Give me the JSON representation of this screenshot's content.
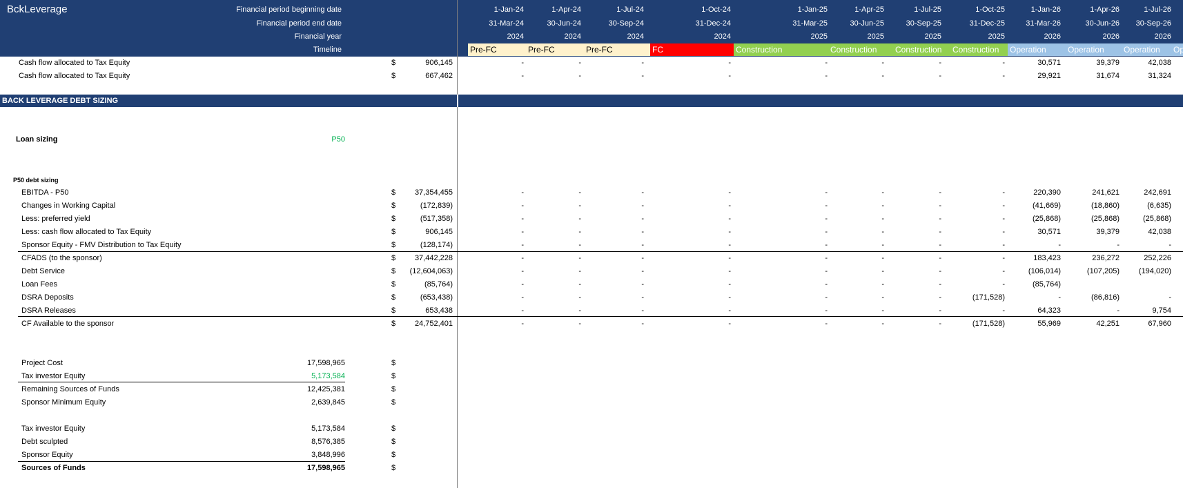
{
  "sheet": {
    "title": "BckLeverage"
  },
  "header": {
    "row_labels": [
      "Financial period beginning date",
      "Financial period end date",
      "Financial year",
      "Timeline"
    ],
    "periods": [
      {
        "begin": "1-Jan-24",
        "end": "31-Mar-24",
        "year": "2024",
        "phase": "Pre-FC"
      },
      {
        "begin": "1-Apr-24",
        "end": "30-Jun-24",
        "year": "2024",
        "phase": "Pre-FC"
      },
      {
        "begin": "1-Jul-24",
        "end": "30-Sep-24",
        "year": "2024",
        "phase": "Pre-FC"
      },
      {
        "begin": "1-Oct-24",
        "end": "31-Dec-24",
        "year": "2024",
        "phase": "FC"
      },
      {
        "begin": "1-Jan-25",
        "end": "31-Mar-25",
        "year": "2025",
        "phase": "Construction"
      },
      {
        "begin": "1-Apr-25",
        "end": "30-Jun-25",
        "year": "2025",
        "phase": "Construction"
      },
      {
        "begin": "1-Jul-25",
        "end": "30-Sep-25",
        "year": "2025",
        "phase": "Construction"
      },
      {
        "begin": "1-Oct-25",
        "end": "31-Dec-25",
        "year": "2025",
        "phase": "Construction"
      },
      {
        "begin": "1-Jan-26",
        "end": "31-Mar-26",
        "year": "2026",
        "phase": "Operation"
      },
      {
        "begin": "1-Apr-26",
        "end": "30-Jun-26",
        "year": "2026",
        "phase": "Operation"
      },
      {
        "begin": "1-Jul-26",
        "end": "30-Sep-26",
        "year": "2026",
        "phase": "Operation"
      },
      {
        "begin": "",
        "end": "",
        "year": "",
        "phase": "Op"
      }
    ]
  },
  "phase_colors": {
    "Pre-FC": "#fff2cc",
    "FC": "#ff0000",
    "Construction": "#92d050",
    "Operation": "#9dc3e6"
  },
  "top_rows": [
    {
      "label": "Cash flow allocated to Tax Equity",
      "unit": "$",
      "total": "906,145",
      "values": [
        "-",
        "-",
        "-",
        "-",
        "-",
        "-",
        "-",
        "-",
        "30,571",
        "39,379",
        "42,038"
      ]
    },
    {
      "label": "Cash flow allocated to Tax Equity",
      "unit": "$",
      "total": "667,462",
      "values": [
        "-",
        "-",
        "-",
        "-",
        "-",
        "-",
        "-",
        "-",
        "29,921",
        "31,674",
        "31,324"
      ]
    }
  ],
  "section": {
    "title": "BACK LEVERAGE DEBT SIZING"
  },
  "loan_sizing": {
    "label": "Loan sizing",
    "value": "P50"
  },
  "debt_sizing": {
    "title": "P50 debt sizing",
    "rows": [
      {
        "label": "EBITDA - P50",
        "unit": "$",
        "total": "37,354,455",
        "values": [
          "-",
          "-",
          "-",
          "-",
          "-",
          "-",
          "-",
          "-",
          "220,390",
          "241,621",
          "242,691"
        ]
      },
      {
        "label": "Changes in Working Capital",
        "unit": "$",
        "total": "(172,839)",
        "values": [
          "-",
          "-",
          "-",
          "-",
          "-",
          "-",
          "-",
          "-",
          "(41,669)",
          "(18,860)",
          "(6,635)"
        ]
      },
      {
        "label": "Less: preferred yield",
        "unit": "$",
        "total": "(517,358)",
        "values": [
          "-",
          "-",
          "-",
          "-",
          "-",
          "-",
          "-",
          "-",
          "(25,868)",
          "(25,868)",
          "(25,868)"
        ]
      },
      {
        "label": "Less: cash flow allocated to Tax Equity",
        "unit": "$",
        "total": "906,145",
        "values": [
          "-",
          "-",
          "-",
          "-",
          "-",
          "-",
          "-",
          "-",
          "30,571",
          "39,379",
          "42,038"
        ]
      },
      {
        "label": "Sponsor Equity - FMV Distribution to Tax Equity",
        "unit": "$",
        "total": "(128,174)",
        "values": [
          "-",
          "-",
          "-",
          "-",
          "-",
          "-",
          "-",
          "-",
          "-",
          "-",
          "-"
        ]
      },
      {
        "label": "CFADS (to the sponsor)",
        "unit": "$",
        "total": "37,442,228",
        "values": [
          "-",
          "-",
          "-",
          "-",
          "-",
          "-",
          "-",
          "-",
          "183,423",
          "236,272",
          "252,226"
        ]
      },
      {
        "label": "Debt Service",
        "unit": "$",
        "total": "(12,604,063)",
        "values": [
          "-",
          "-",
          "-",
          "-",
          "-",
          "-",
          "-",
          "-",
          "(106,014)",
          "(107,205)",
          "(194,020)"
        ]
      },
      {
        "label": "Loan Fees",
        "unit": "$",
        "total": "(85,764)",
        "values": [
          "-",
          "-",
          "-",
          "-",
          "-",
          "-",
          "-",
          "-",
          "(85,764)",
          "",
          ""
        ]
      },
      {
        "label": "DSRA Deposits",
        "unit": "$",
        "total": "(653,438)",
        "values": [
          "-",
          "-",
          "-",
          "-",
          "-",
          "-",
          "-",
          "(171,528)",
          "-",
          "(86,816)",
          "-"
        ]
      },
      {
        "label": "DSRA Releases",
        "unit": "$",
        "total": "653,438",
        "values": [
          "-",
          "-",
          "-",
          "-",
          "-",
          "-",
          "-",
          "-",
          "64,323",
          "-",
          "9,754"
        ]
      },
      {
        "label": "CF Available to the sponsor",
        "unit": "$",
        "total": "24,752,401",
        "values": [
          "-",
          "-",
          "-",
          "-",
          "-",
          "-",
          "-",
          "(171,528)",
          "55,969",
          "42,251",
          "67,960"
        ]
      }
    ]
  },
  "funding": {
    "block1": [
      {
        "label": "Project Cost",
        "value": "17,598,965",
        "unit": "$"
      },
      {
        "label": "Tax investor Equity",
        "value": "5,173,584",
        "unit": "$"
      },
      {
        "label": "Remaining Sources of Funds",
        "value": "12,425,381",
        "unit": "$"
      },
      {
        "label": "Sponsor Minimum Equity",
        "value": "2,639,845",
        "unit": "$"
      }
    ],
    "block2": [
      {
        "label": "Tax investor Equity",
        "value": "5,173,584",
        "unit": "$"
      },
      {
        "label": "Debt sculpted",
        "value": "8,576,385",
        "unit": "$"
      },
      {
        "label": "Sponsor Equity",
        "value": "3,848,996",
        "unit": "$"
      },
      {
        "label": "Sources of Funds",
        "value": "17,598,965",
        "unit": "$"
      }
    ]
  }
}
